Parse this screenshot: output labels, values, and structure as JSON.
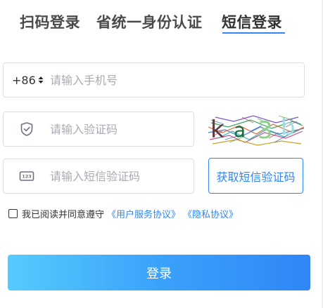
{
  "tabs": [
    {
      "label": "扫码登录"
    },
    {
      "label": "省统一身份认证"
    },
    {
      "label": "短信登录"
    }
  ],
  "phone": {
    "country_code": "+86",
    "placeholder": "请输入手机号",
    "value": ""
  },
  "captcha": {
    "placeholder": "请输入验证码",
    "value": "",
    "image_text": "ka3b"
  },
  "sms": {
    "placeholder": "请输入短信验证码",
    "value": "",
    "button_label": "获取短信验证码"
  },
  "agreement": {
    "text": "我已阅读并同意遵守",
    "user_service_link": "《用户服务协议》",
    "privacy_link": "《隐私协议》",
    "checked": false
  },
  "login_button": {
    "label": "登录"
  },
  "colors": {
    "accent": "#2f86f6",
    "button_gradient_start": "#56cbfd",
    "button_gradient_end": "#2f86f6"
  }
}
